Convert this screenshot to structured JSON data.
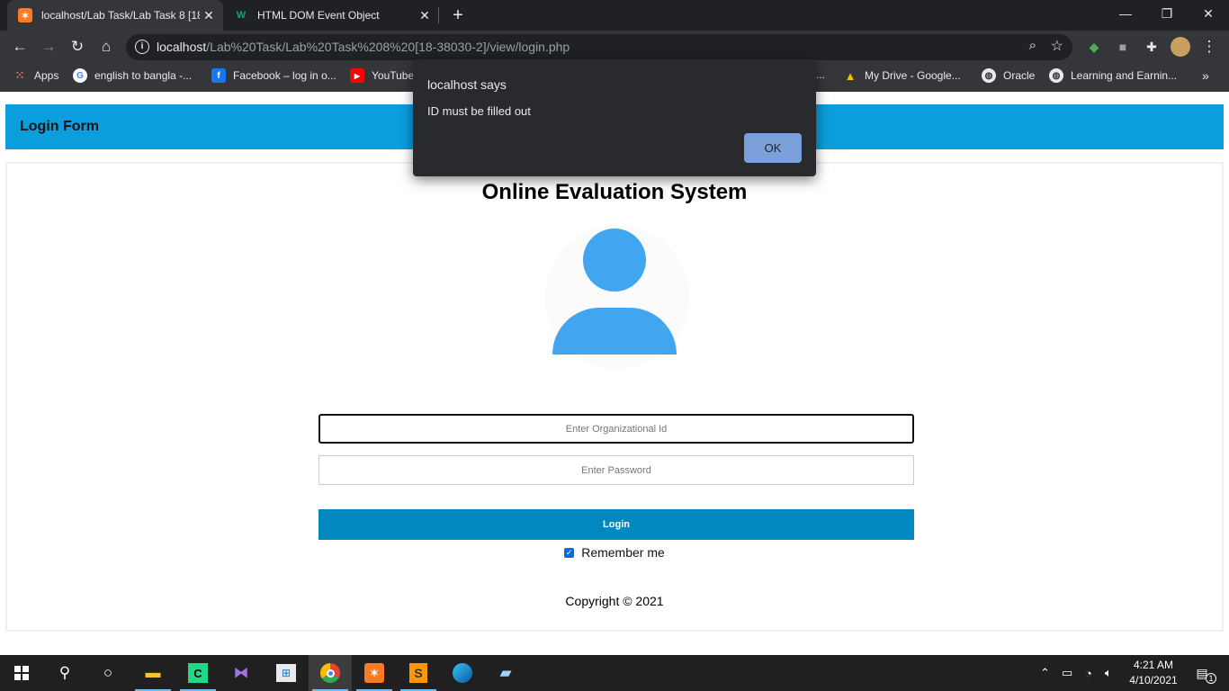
{
  "browser": {
    "tabs": [
      {
        "title": "localhost/Lab Task/Lab Task 8 [18",
        "icon": "xampp-icon",
        "active": true
      },
      {
        "title": "HTML DOM Event Object",
        "icon": "w3schools-icon",
        "active": false
      }
    ],
    "new_tab": "+",
    "window_controls": {
      "minimize": "—",
      "restore": "❐",
      "close": "✕"
    },
    "url_host": "localhost",
    "url_path": "/Lab%20Task/Lab%20Task%208%20[18-38030-2]/view/login.php",
    "bookmarks": [
      {
        "label": "Apps",
        "icon": "apps-grid-icon"
      },
      {
        "label": "english to bangla -...",
        "icon": "google-icon"
      },
      {
        "label": "Facebook – log in o...",
        "icon": "facebook-icon"
      },
      {
        "label": "YouTube",
        "icon": "youtube-icon"
      },
      {
        "label": "...",
        "icon": ""
      },
      {
        "label": "My Drive - Google...",
        "icon": "google-drive-icon"
      },
      {
        "label": "Oracle",
        "icon": "globe-icon"
      },
      {
        "label": "Learning and Earnin...",
        "icon": "globe-icon"
      }
    ],
    "more_bookmarks": "»"
  },
  "page": {
    "header_title": "Login Form",
    "system_title": "Online Evaluation System",
    "id_placeholder": "Enter Organizational Id",
    "password_placeholder": "Enter Password",
    "login_label": "Login",
    "remember_label": "Remember me",
    "remember_checked": true,
    "copyright": "Copyright © 2021"
  },
  "dialog": {
    "title": "localhost says",
    "message": "ID must be filled out",
    "ok_label": "OK"
  },
  "taskbar": {
    "time": "4:21 AM",
    "date": "4/10/2021",
    "notification_count": "1"
  },
  "colors": {
    "header": "#0b9edc",
    "login_button": "#0088bf",
    "avatar": "#42a5f0",
    "dialog_ok": "#8ab4f8"
  }
}
